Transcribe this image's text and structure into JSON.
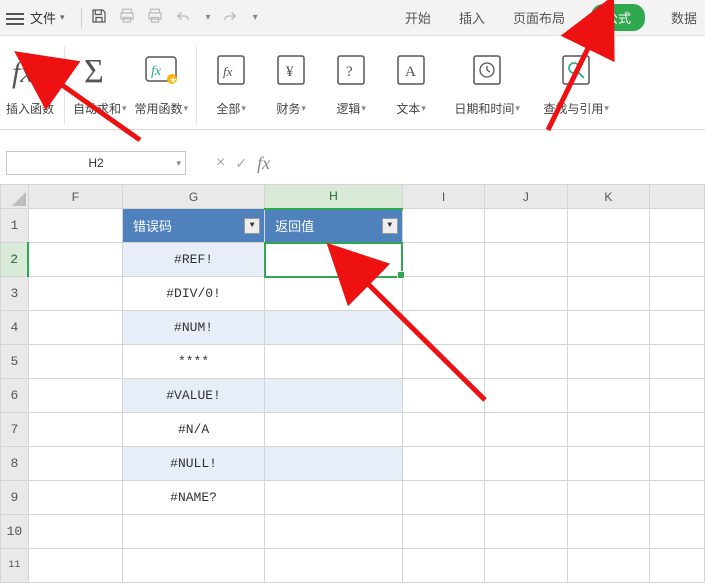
{
  "menubar": {
    "file_label": "文件",
    "tabs": [
      "开始",
      "插入",
      "页面布局",
      "公式",
      "数据"
    ],
    "active_tab": "公式"
  },
  "ribbon": {
    "insert_fn": "插入函数",
    "autosum": "自动求和",
    "common": "常用函数",
    "all": "全部",
    "finance": "财务",
    "logic": "逻辑",
    "text": "文本",
    "datetime": "日期和时间",
    "lookup": "查找与引用"
  },
  "formula_bar": {
    "namebox_value": "H2",
    "cancel": "×",
    "accept": "✓",
    "fx": "fx"
  },
  "grid": {
    "col_headers": [
      "F",
      "G",
      "H",
      "I",
      "J",
      "K"
    ],
    "selected_col": "H",
    "selected_row": 2,
    "row_count": 11,
    "table_header": {
      "col1": "错误码",
      "col2": "返回值"
    },
    "rows": [
      {
        "g": "#REF!",
        "h": ""
      },
      {
        "g": "#DIV/0!",
        "h": ""
      },
      {
        "g": "#NUM!",
        "h": ""
      },
      {
        "g": "****",
        "h": ""
      },
      {
        "g": "#VALUE!",
        "h": ""
      },
      {
        "g": "#N/A",
        "h": ""
      },
      {
        "g": "#NULL!",
        "h": ""
      },
      {
        "g": "#NAME?",
        "h": ""
      }
    ]
  }
}
